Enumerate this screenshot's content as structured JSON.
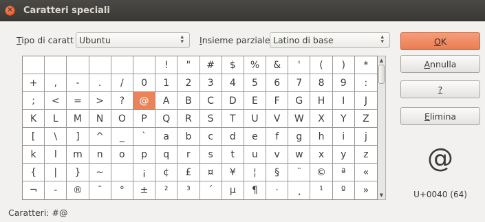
{
  "window": {
    "title": "Caratteri speciali"
  },
  "options": {
    "font_label_u": "T",
    "font_label_rest": "ipo di caratt",
    "font_value": "Ubuntu",
    "subset_label_u": "I",
    "subset_label_rest": "nsieme parziale",
    "subset_value": "Latino di base"
  },
  "grid": {
    "rows": [
      [
        "",
        "",
        "",
        "",
        "",
        "",
        "!",
        "\"",
        "#",
        "$",
        "%",
        "&",
        "'",
        "(",
        ")",
        "*"
      ],
      [
        "+",
        ",",
        "-",
        ".",
        "/",
        "0",
        "1",
        "2",
        "3",
        "4",
        "5",
        "6",
        "7",
        "8",
        "9",
        ":"
      ],
      [
        ";",
        "<",
        "=",
        ">",
        "?",
        "@",
        "A",
        "B",
        "C",
        "D",
        "E",
        "F",
        "G",
        "H",
        "I",
        "J"
      ],
      [
        "K",
        "L",
        "M",
        "N",
        "O",
        "P",
        "Q",
        "R",
        "S",
        "T",
        "U",
        "V",
        "W",
        "X",
        "Y",
        "Z"
      ],
      [
        "[",
        "\\",
        "]",
        "^",
        "_",
        "`",
        "a",
        "b",
        "c",
        "d",
        "e",
        "f",
        "g",
        "h",
        "i",
        "j"
      ],
      [
        "k",
        "l",
        "m",
        "n",
        "o",
        "p",
        "q",
        "r",
        "s",
        "t",
        "u",
        "v",
        "w",
        "x",
        "y",
        "z"
      ],
      [
        "{",
        "|",
        "}",
        "~",
        "",
        "¡",
        "¢",
        "£",
        "¤",
        "¥",
        "¦",
        "§",
        "¨",
        "©",
        "ª",
        "«"
      ],
      [
        "¬",
        "-",
        "®",
        "¯",
        "°",
        "±",
        "²",
        "³",
        "´",
        "µ",
        "¶",
        "·",
        "¸",
        "¹",
        "º",
        "»"
      ]
    ],
    "selected": "@"
  },
  "buttons": {
    "ok_u": "O",
    "ok_rest": "K",
    "cancel_u": "A",
    "cancel_rest": "nnulla",
    "help_u": "?",
    "help_rest": "",
    "delete_u": "E",
    "delete_rest": "limina"
  },
  "preview": {
    "char": "@",
    "code": "U+0040 (64)"
  },
  "footer": {
    "label": "Caratteri:",
    "value": "#@"
  },
  "colors": {
    "accent": "#e9835a",
    "titlebar": "#3c3b37"
  }
}
